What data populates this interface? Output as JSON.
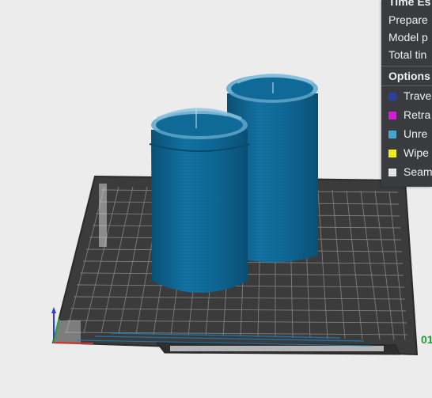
{
  "legend": {
    "title": "Time Es",
    "stats": [
      {
        "label": "Prepare"
      },
      {
        "label": "Model p"
      },
      {
        "label": "Total tin"
      }
    ],
    "options_title": "Options",
    "options": [
      {
        "label": "Trave",
        "color": "#2f3fa0"
      },
      {
        "label": "Retra",
        "color": "#d31ed8"
      },
      {
        "label": "Unre",
        "color": "#45a6d0"
      },
      {
        "label": "Wipe",
        "color": "#f2ee1a"
      },
      {
        "label": "Seam",
        "color": "#e6e6e6"
      }
    ]
  },
  "viewport": {
    "axis_label": "01",
    "model_color": "#0d5d86",
    "bed_color": "#3a3a3a"
  }
}
